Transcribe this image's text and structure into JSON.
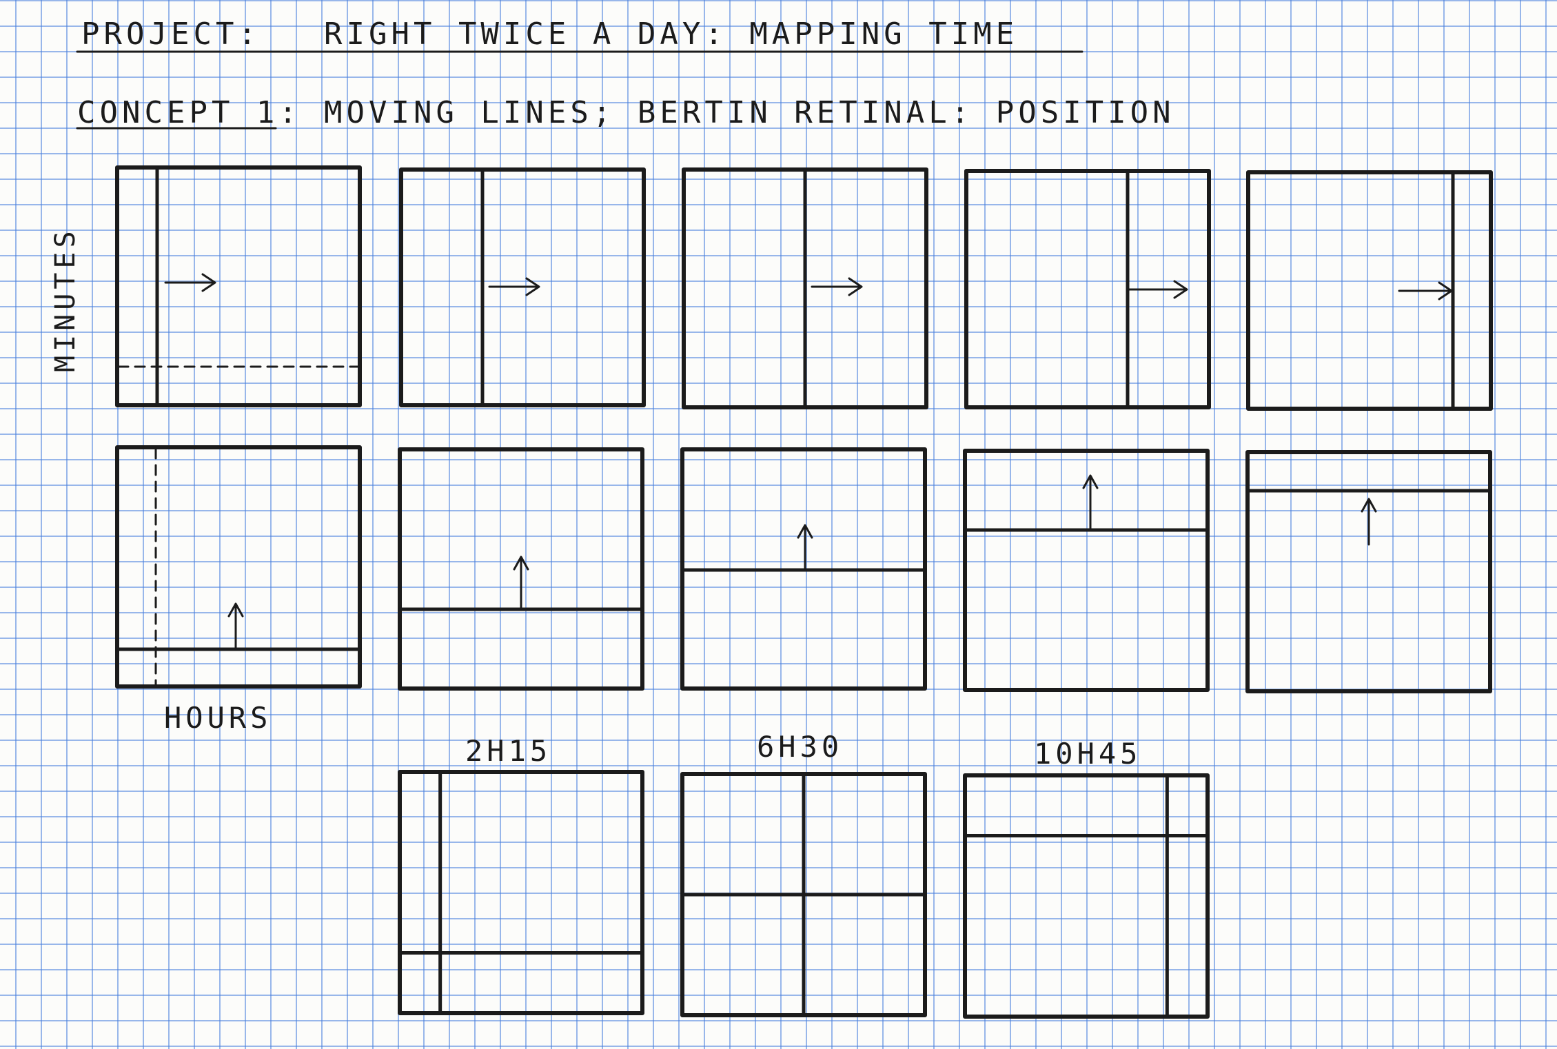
{
  "header": {
    "project_label": "PROJECT:",
    "project_title": "RIGHT TWICE A DAY: MAPPING TIME",
    "concept_label": "CONCEPT 1:",
    "concept_title": "MOVING LINES; BERTIN RETINAL: POSITION"
  },
  "axes": {
    "vertical_label": "MINUTES",
    "horizontal_label": "HOURS"
  },
  "examples": [
    {
      "label": "2H15",
      "hours": 2,
      "minutes": 15
    },
    {
      "label": "6H30",
      "hours": 6,
      "minutes": 30
    },
    {
      "label": "10H45",
      "hours": 10,
      "minutes": 45
    }
  ],
  "row_minutes": {
    "description_steps": 5
  },
  "colors": {
    "ink": "#1b1b1b",
    "grid": "#467ddc",
    "paper": "#fcfcfa"
  }
}
